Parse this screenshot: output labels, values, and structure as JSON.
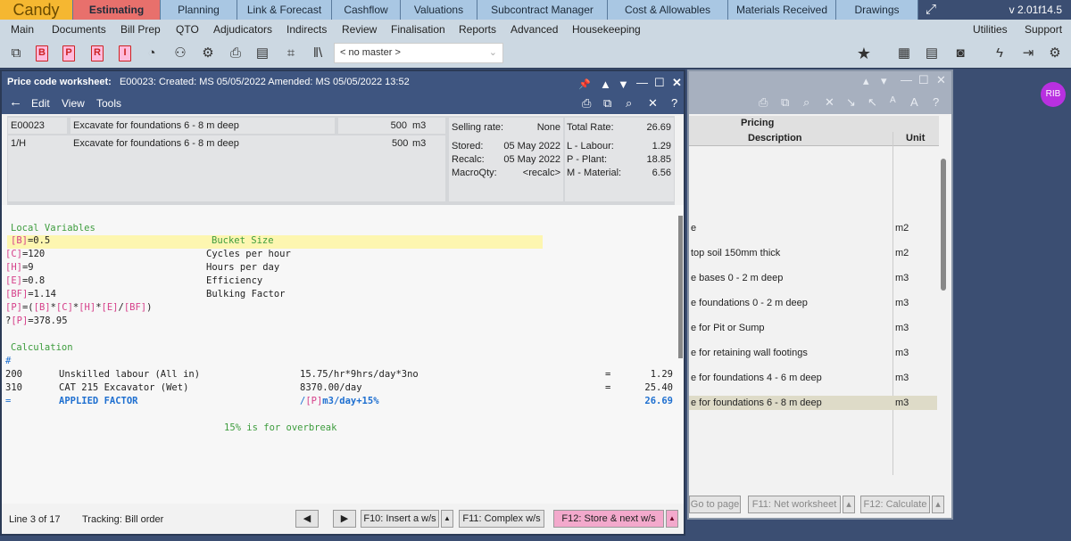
{
  "app": {
    "name": "Candy",
    "version": "v 2.01f14.5",
    "user_badge": "RIB"
  },
  "tabs": [
    "Estimating",
    "Planning",
    "Link & Forecast",
    "Cashflow",
    "Valuations",
    "Subcontract Manager",
    "Cost & Allowables",
    "Materials Received",
    "Drawings"
  ],
  "menu": [
    "Main",
    "Documents",
    "Bill Prep",
    "QTO",
    "Adjudicators",
    "Indirects",
    "Review",
    "Finalisation",
    "Reports",
    "Advanced",
    "Housekeeping"
  ],
  "menu_right": [
    "Utilities",
    "Support"
  ],
  "master_select": "< no master >",
  "worksheet": {
    "title_label": "Price code worksheet:",
    "title_info": "E00023:  Created: MS  05/05/2022 Amended: MS  05/05/2022 13:52",
    "menu": [
      "Edit",
      "View",
      "Tools"
    ],
    "header": {
      "code": "E00023",
      "description": "Excavate for foundations 6 - 8 m deep",
      "qty": "500",
      "unit": "m3",
      "ref": "1/H",
      "ref_description": "Excavate for foundations 6 - 8 m deep",
      "ref_qty": "500",
      "ref_unit": "m3",
      "selling_rate_label": "Selling rate:",
      "selling_rate": "None",
      "total_rate_label": "Total Rate:",
      "total_rate": "26.69",
      "stored_label": "Stored:",
      "stored": "05 May 2022",
      "recalc_label": "Recalc:",
      "recalc": "05 May 2022",
      "macroqty_label": "MacroQty:",
      "macroqty": "<recalc>",
      "labour_label": "L - Labour:",
      "labour": "1.29",
      "plant_label": "P - Plant:",
      "plant": "18.85",
      "material_label": "M - Material:",
      "material": "6.56"
    },
    "code": {
      "local_vars_heading": "Local Variables",
      "vars": [
        {
          "name": "B",
          "value": "=0.5",
          "comment": "Bucket Size"
        },
        {
          "name": "C",
          "value": "=120",
          "comment": "Cycles per hour"
        },
        {
          "name": "H",
          "value": "=9",
          "comment": "Hours per day"
        },
        {
          "name": "E",
          "value": "=0.8",
          "comment": "Efficiency"
        },
        {
          "name": "BF",
          "value": "=1.14",
          "comment": "Bulking Factor"
        }
      ],
      "formula": "[P]=([B]*[C]*[H]*[E]/[BF])",
      "result": "?[P]=378.95",
      "calc_heading": "Calculation",
      "hash": "#",
      "lines": [
        {
          "code": "200",
          "desc": "Unskilled labour (All in)",
          "calc": "15.75/hr*9hrs/day*3no",
          "eq": "=",
          "value": "1.29"
        },
        {
          "code": "310",
          "desc": "CAT 215 Excavator (Wet)",
          "calc": "8370.00/day",
          "eq": "=",
          "value": "25.40"
        }
      ],
      "factor": {
        "code": "=",
        "desc": "APPLIED FACTOR",
        "calc_var": "[P]",
        "calc_rest": "m3/day+15%",
        "value": "26.69"
      },
      "note": "15% is for overbreak"
    },
    "status": {
      "line": "Line 3 of 17",
      "tracking": "Tracking: Bill order"
    },
    "buttons": {
      "f10": "F10: Insert a w/s",
      "f11": "F11: Complex w/s",
      "f12": "F12: Store & next w/s"
    }
  },
  "pricing": {
    "group_header": "Pricing",
    "col_description": "Description",
    "col_unit": "Unit",
    "rows": [
      {
        "desc": "e",
        "unit": "m2"
      },
      {
        "desc": "top soil 150mm thick",
        "unit": "m2"
      },
      {
        "desc": "e bases 0 - 2 m deep",
        "unit": "m3"
      },
      {
        "desc": "e foundations 0 - 2 m deep",
        "unit": "m3"
      },
      {
        "desc": "e for Pit or Sump",
        "unit": "m3"
      },
      {
        "desc": "e for retaining wall footings",
        "unit": "m3"
      },
      {
        "desc": "e for foundations 4 - 6 m deep",
        "unit": "m3"
      },
      {
        "desc": "e for foundations 6 - 8 m deep",
        "unit": "m3"
      }
    ],
    "selected_row": 7,
    "buttons": {
      "goto": "Go to page",
      "f11": "F11: Net worksheet",
      "f12": "F12: Calculate"
    }
  },
  "colors": {
    "candy": "#f5b731",
    "estimating": "#e8706c",
    "tabs": "#a9c7e3",
    "navy": "#3e5580",
    "highlight": "#fdf6b0",
    "f12": "#f3a9cc"
  }
}
